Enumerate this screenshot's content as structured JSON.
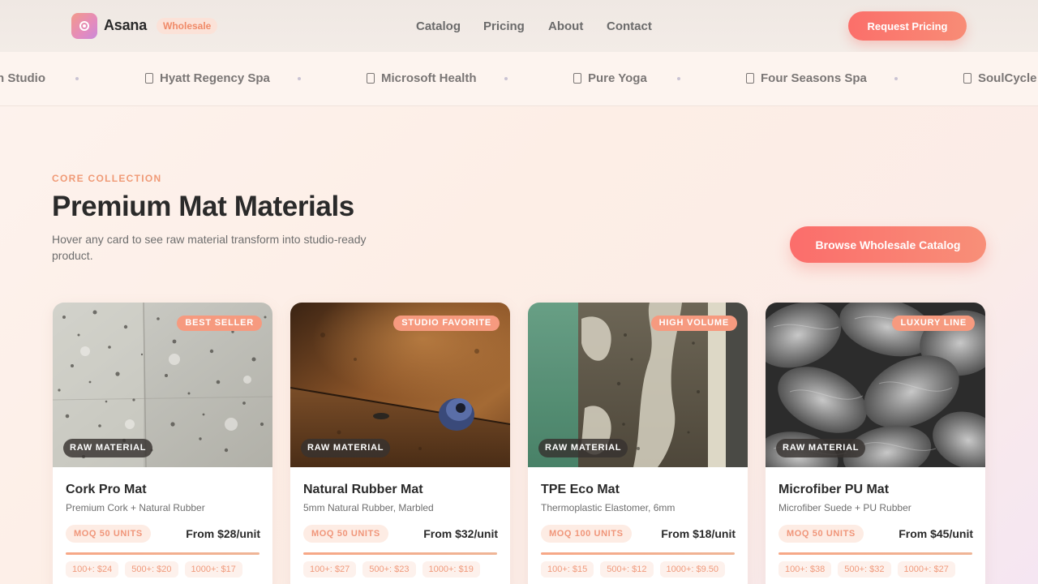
{
  "header": {
    "brand": "Asana",
    "badge": "Wholesale",
    "nav": [
      "Catalog",
      "Pricing",
      "About",
      "Contact"
    ],
    "cta": "Request Pricing"
  },
  "clients": [
    "n Studio",
    "Hyatt Regency Spa",
    "Microsoft Health",
    "Pure Yoga",
    "Four Seasons Spa",
    "SoulCycle"
  ],
  "section": {
    "eyebrow": "CORE COLLECTION",
    "title": "Premium Mat Materials",
    "subtitle": "Hover any card to see raw material transform into studio-ready product.",
    "cta": "Browse Wholesale Catalog"
  },
  "cards": [
    {
      "tag": "BEST SELLER",
      "raw_label": "RAW MATERIAL",
      "title": "Cork Pro Mat",
      "spec": "Premium Cork + Natural Rubber",
      "moq": "MOQ 50 UNITS",
      "price": "From $28/unit",
      "tiers": [
        "100+: $24",
        "500+: $20",
        "1000+: $17"
      ]
    },
    {
      "tag": "STUDIO FAVORITE",
      "raw_label": "RAW MATERIAL",
      "title": "Natural Rubber Mat",
      "spec": "5mm Natural Rubber, Marbled",
      "moq": "MOQ 50 UNITS",
      "price": "From $32/unit",
      "tiers": [
        "100+: $27",
        "500+: $23",
        "1000+: $19"
      ]
    },
    {
      "tag": "HIGH VOLUME",
      "raw_label": "RAW MATERIAL",
      "title": "TPE Eco Mat",
      "spec": "Thermoplastic Elastomer, 6mm",
      "moq": "MOQ 100 UNITS",
      "price": "From $18/unit",
      "tiers": [
        "100+: $15",
        "500+: $12",
        "1000+: $9.50"
      ]
    },
    {
      "tag": "LUXURY LINE",
      "raw_label": "RAW MATERIAL",
      "title": "Microfiber PU Mat",
      "spec": "Microfiber Suede + PU Rubber",
      "moq": "MOQ 50 UNITS",
      "price": "From $45/unit",
      "tiers": [
        "100+: $38",
        "500+: $32",
        "1000+: $27"
      ]
    }
  ],
  "colors": {
    "accent": "#fb6f6a",
    "accent_light": "#f88c76",
    "eyebrow": "#f09a76",
    "text": "#2a2a2a",
    "muted": "#6e6e6e"
  }
}
